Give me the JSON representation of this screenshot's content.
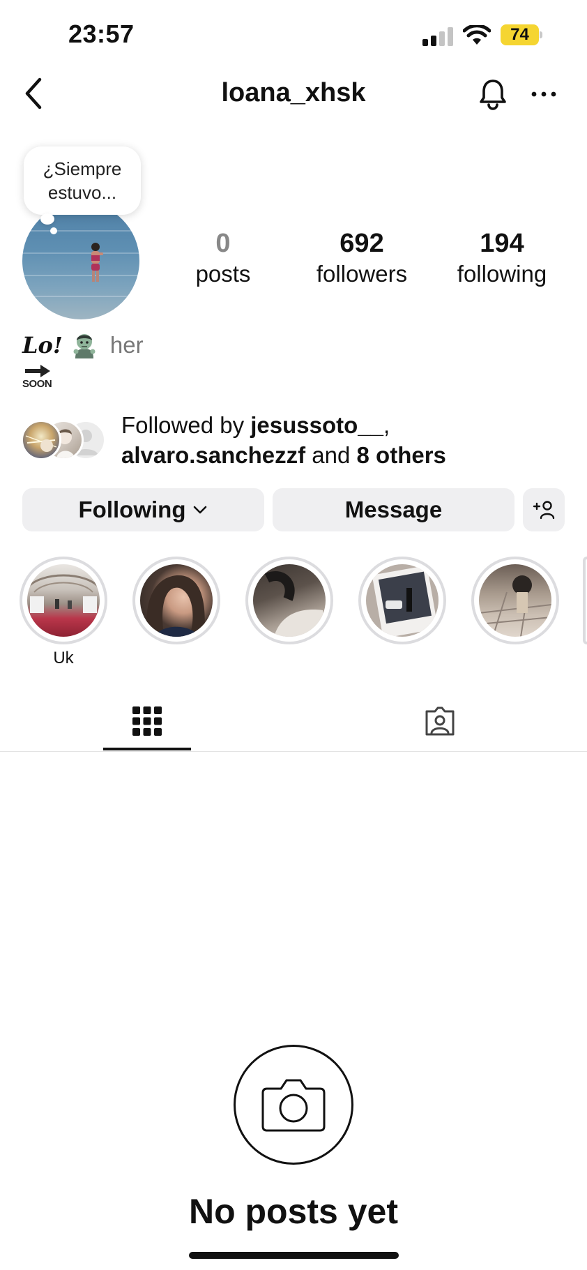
{
  "status_bar": {
    "time": "23:57",
    "battery": "74",
    "battery_color": "#f5d531"
  },
  "header": {
    "username": "loana_xhsk",
    "back_icon": "chevron-left-icon",
    "bell_icon": "bell-icon",
    "more_icon": "more-horizontal-icon"
  },
  "note": {
    "text": "¿Siempre estuvo..."
  },
  "stats": [
    {
      "number": "0",
      "label": "posts"
    },
    {
      "number": "692",
      "label": "followers"
    },
    {
      "number": "194",
      "label": "following"
    }
  ],
  "bio": {
    "name": "Lo!",
    "pronouns": "her",
    "badge": "SOON"
  },
  "followed_by": {
    "prefix": "Followed by ",
    "user1": "jesussoto__",
    "separator": ",",
    "user2": "alvaro.sanchezzf",
    "and": " and ",
    "others": "8 others"
  },
  "buttons": {
    "following": "Following",
    "message": "Message",
    "add_user_icon": "add-person-icon"
  },
  "highlights": [
    {
      "label": "Uk"
    },
    {
      "label": ""
    },
    {
      "label": ""
    },
    {
      "label": ""
    },
    {
      "label": ""
    }
  ],
  "tabs": [
    {
      "name": "posts-grid",
      "icon": "grid-icon",
      "active": true
    },
    {
      "name": "tagged",
      "icon": "tagged-person-icon",
      "active": false
    }
  ],
  "empty_state": {
    "title": "No posts yet",
    "icon": "camera-icon"
  }
}
